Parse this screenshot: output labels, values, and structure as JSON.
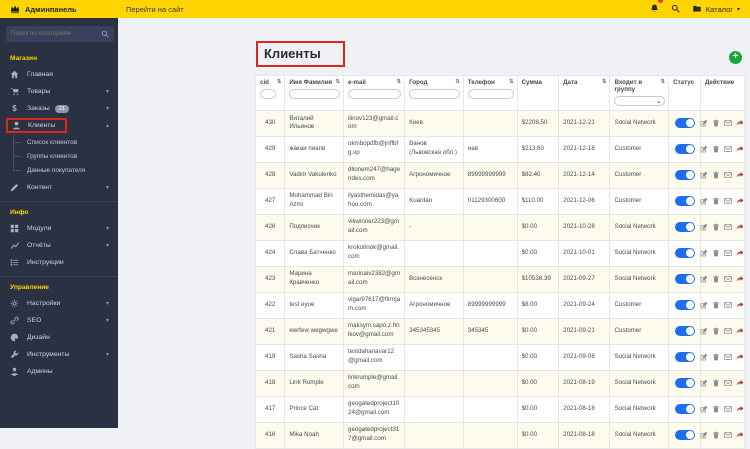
{
  "colors": {
    "topbar": "#ffd400",
    "sidebar": "#2a3142",
    "section_header": "#ffd400",
    "annotation_box": "#e0261c",
    "toggle_on": "#1f6ef0",
    "add_button": "#19a63c",
    "notification_badge": "#e33529"
  },
  "topbar": {
    "brand": "Админпанель",
    "goto_site": "Перейти на сайт",
    "catalog_label": "Каталог"
  },
  "sidebar": {
    "search_placeholder": "Поиск по категориям",
    "sections": [
      {
        "header": "Магазин",
        "items": [
          {
            "id": "home",
            "icon": "home",
            "label": "Главная"
          },
          {
            "id": "products",
            "icon": "cart",
            "label": "Товары",
            "arrow": "down"
          },
          {
            "id": "orders",
            "icon": "dollar",
            "label": "Заказы",
            "badge": "21",
            "arrow": "down"
          },
          {
            "id": "clients",
            "icon": "user",
            "label": "Клиенты",
            "arrow": "up",
            "annotated": true,
            "subitems": [
              {
                "id": "clients-list",
                "label": "Список клиентов"
              },
              {
                "id": "client-groups",
                "label": "Группы клиентов"
              },
              {
                "id": "customer-data",
                "label": "Данные покупателя"
              }
            ]
          },
          {
            "id": "content",
            "icon": "pencil",
            "label": "Контент",
            "arrow": "down"
          }
        ]
      },
      {
        "header": "Инфо",
        "items": [
          {
            "id": "modules",
            "icon": "modules",
            "label": "Модули",
            "arrow": "down"
          },
          {
            "id": "reports",
            "icon": "chart",
            "label": "Отчёты",
            "arrow": "down"
          },
          {
            "id": "instructions",
            "icon": "list",
            "label": "Инструкции"
          }
        ]
      },
      {
        "header": "Управление",
        "items": [
          {
            "id": "settings",
            "icon": "gear",
            "label": "Настройки",
            "arrow": "down"
          },
          {
            "id": "seo",
            "icon": "link",
            "label": "SEO",
            "arrow": "down"
          },
          {
            "id": "design",
            "icon": "palette",
            "label": "Дизайн"
          },
          {
            "id": "tools",
            "icon": "tools",
            "label": "Инструменты",
            "arrow": "down"
          },
          {
            "id": "admins",
            "icon": "admin",
            "label": "Админы"
          }
        ]
      }
    ]
  },
  "main": {
    "title": "Клиенты",
    "add_button": "+",
    "table": {
      "columns": [
        {
          "key": "cid",
          "label": "cid",
          "sort": true,
          "filter": "input-small"
        },
        {
          "key": "name",
          "label": "Имя Фамилия",
          "sort": true,
          "filter": "input"
        },
        {
          "key": "email",
          "label": "e-mail",
          "sort": true,
          "filter": "input"
        },
        {
          "key": "city",
          "label": "Город",
          "sort": true,
          "filter": "input"
        },
        {
          "key": "phone",
          "label": "Телефон",
          "sort": true,
          "filter": "input"
        },
        {
          "key": "sum",
          "label": "Сумма"
        },
        {
          "key": "date",
          "label": "Дата",
          "sort": true
        },
        {
          "key": "group",
          "label": "Входит в группу",
          "sort": true,
          "filter": "select"
        },
        {
          "key": "status",
          "label": "Статус"
        },
        {
          "key": "action",
          "label": "Действие"
        }
      ],
      "rows": [
        {
          "cid": "430",
          "name": "Виталий Ильинов",
          "email": "ilinov123@gmail.com",
          "city": "Киев",
          "phone": "",
          "sum": "$2208.50",
          "date": "2021-12-21",
          "group": "Social Network",
          "status": true
        },
        {
          "cid": "429",
          "name": "жакаи пиапв",
          "email": "okmbopdfb@jnffbfg.vp",
          "city": "Ванов (Львовская обл.)",
          "phone": "иав",
          "sum": "$213.60",
          "date": "2021-12-18",
          "group": "Customer",
          "status": true
        },
        {
          "cid": "428",
          "name": "Vadim Vakulenko",
          "email": "dlionem247@hagendes.com",
          "city": "Агрономичное",
          "phone": "89999999999",
          "sum": "$82.40",
          "date": "2021-12-14",
          "group": "Customer",
          "status": true
        },
        {
          "cid": "427",
          "name": "Mohammad Bin Azmi",
          "email": "ilyasthemidas@yahoo.com",
          "city": "Kuantan",
          "phone": "01129300600",
          "sum": "$110.00",
          "date": "2021-12-06",
          "group": "Customer",
          "status": true
        },
        {
          "cid": "426",
          "name": "Подписчик",
          "email": "vikwinner223@gmail.com",
          "city": "-",
          "phone": "",
          "sum": "$0.00",
          "date": "2021-10-28",
          "group": "Social Network",
          "status": true
        },
        {
          "cid": "424",
          "name": "Слава Батченко",
          "email": "krokotinok@gmail.com",
          "city": "",
          "phone": "",
          "sum": "$0.00",
          "date": "2021-10-01",
          "group": "Social Network",
          "status": true
        },
        {
          "cid": "423",
          "name": "Марина Кравченко",
          "email": "marinaiv2382@gmail.com",
          "city": "Вознесенск",
          "phone": "",
          "sum": "$10538.39",
          "date": "2021-09-27",
          "group": "Social Network",
          "status": true
        },
        {
          "cid": "422",
          "name": "test eyue",
          "email": "vigar97617@firmjam.com",
          "city": "Агрономичное",
          "phone": "89999999999",
          "sum": "$8.00",
          "date": "2021-09-24",
          "group": "Customer",
          "status": true
        },
        {
          "cid": "421",
          "name": "ewrfew wegwgwe",
          "email": "maksym.sapo.z.hnikov@gmail.com",
          "city": "345345345",
          "phone": "345345",
          "sum": "$0.00",
          "date": "2021-09-21",
          "group": "Customer",
          "status": true
        },
        {
          "cid": "419",
          "name": "Sasha Sasha",
          "email": "testdahanavar12@gmail.com",
          "city": "",
          "phone": "",
          "sum": "$0.00",
          "date": "2021-09-08",
          "group": "Social Network",
          "status": true
        },
        {
          "cid": "418",
          "name": "Link Rumple",
          "email": "linkrumple@gmail.com",
          "city": "",
          "phone": "",
          "sum": "$0.00",
          "date": "2021-08-19",
          "group": "Social Network",
          "status": true
        },
        {
          "cid": "417",
          "name": "Prince Cat",
          "email": "geogatedproject1024@gmail.com",
          "city": "",
          "phone": "",
          "sum": "$0.00",
          "date": "2021-08-18",
          "group": "Social Network",
          "status": true
        },
        {
          "cid": "416",
          "name": "Mika Noah",
          "email": "geogatedproject317@gmail.com",
          "city": "",
          "phone": "",
          "sum": "$0.00",
          "date": "2021-08-18",
          "group": "Social Network",
          "status": true
        }
      ]
    }
  }
}
